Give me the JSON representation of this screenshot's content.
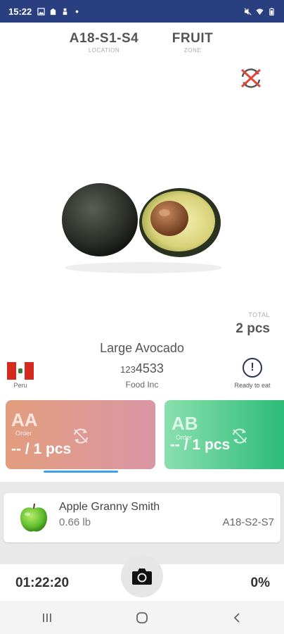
{
  "status_bar": {
    "time": "15:22",
    "left_icons": [
      "image-icon",
      "notification-icon",
      "upload-icon",
      "dot-icon"
    ],
    "right_icons": [
      "mute-icon",
      "wifi-icon",
      "battery-icon"
    ]
  },
  "header": {
    "location": {
      "value": "A18-S1-S4",
      "label": "LOCATION"
    },
    "zone": {
      "value": "FRUIT",
      "label": "ZONE"
    }
  },
  "product": {
    "image_icon": "avocado-image",
    "name": "Large Avocado",
    "code_prefix": "123",
    "code_main": "4533",
    "supplier": "Food Inc",
    "origin_country": "Peru",
    "origin_flag_colors": [
      "#d52b1e",
      "#ffffff",
      "#d52b1e"
    ],
    "ready_label": "Ready to eat",
    "ready_icon": "!",
    "total_label": "TOTAL",
    "total_value": "2 pcs"
  },
  "orders": [
    {
      "code": "AA",
      "label": "Order",
      "quantity": "-- / 1 pcs",
      "icon": "sync-icon"
    },
    {
      "code": "AB",
      "label": "Order",
      "quantity": "-- / 1 pcs",
      "icon": "sync-icon"
    }
  ],
  "list": [
    {
      "name": "Apple Granny Smith",
      "weight": "0.66 lb",
      "location": "A18-S2-S7",
      "icon": "green-apple-icon"
    }
  ],
  "footer": {
    "timer": "01:22:20",
    "progress": "0%",
    "camera_icon": "camera-icon"
  },
  "nav": [
    "recent-apps-icon",
    "home-icon",
    "back-icon"
  ],
  "colors": {
    "status_bar": "#2a3f7f",
    "card_aa_start": "#e39d7e",
    "card_aa_end": "#d996a4",
    "card_ab_start": "#8ae0af",
    "card_ab_end": "#2dbb78",
    "indicator": "#3aa0ef"
  }
}
